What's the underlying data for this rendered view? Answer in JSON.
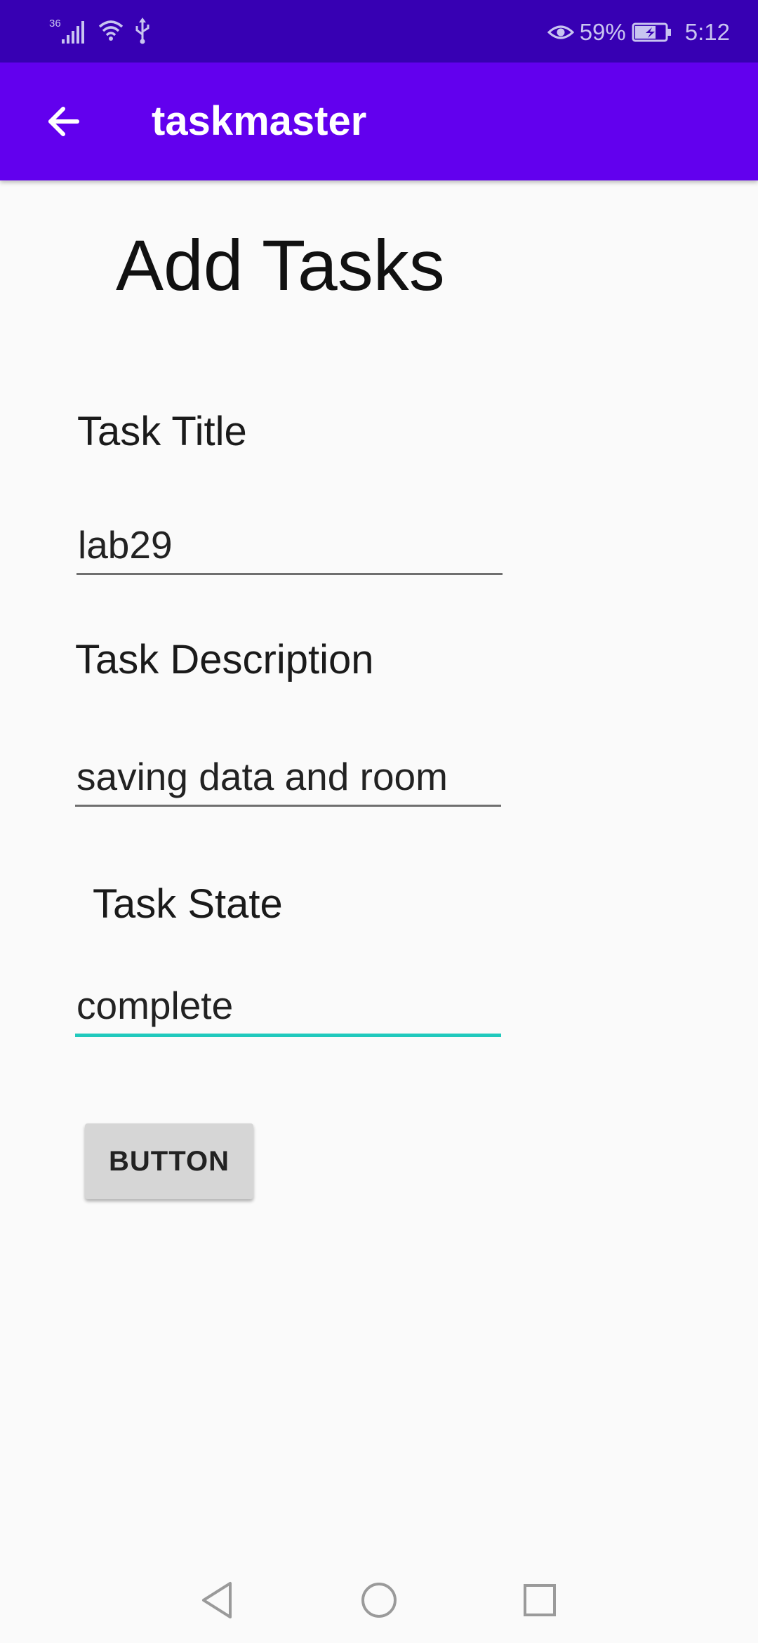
{
  "status_bar": {
    "network": "36",
    "battery_percent": "59%",
    "time": "5:12"
  },
  "app_bar": {
    "title": "taskmaster",
    "back_icon": "arrow-back-icon",
    "background_color": "#6200ee"
  },
  "page": {
    "heading": "Add Tasks"
  },
  "form": {
    "title_label": "Task Title",
    "title_value": "lab29",
    "description_label": "Task Description",
    "description_value": "saving data and room",
    "state_label": "Task State",
    "state_value": "complete",
    "submit_label": "BUTTON",
    "focus_color": "#21c9bd"
  },
  "nav_bar": {
    "icons": [
      "back-triangle-icon",
      "home-circle-icon",
      "recents-square-icon"
    ]
  }
}
